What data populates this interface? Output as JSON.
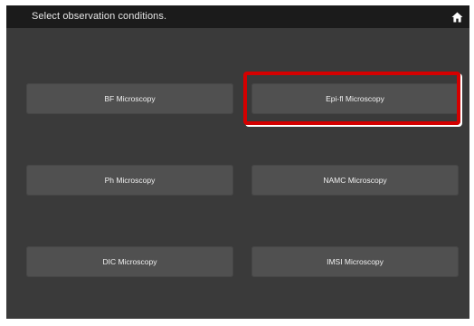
{
  "header": {
    "title": "Select observation conditions.",
    "home_icon": "home-icon"
  },
  "options": [
    {
      "label": "BF Microscopy"
    },
    {
      "label": "Epi-fl Microscopy",
      "highlighted": true
    },
    {
      "label": "Ph Microscopy"
    },
    {
      "label": "NAMC Microscopy"
    },
    {
      "label": "DIC Microscopy"
    },
    {
      "label": "IMSI Microscopy"
    }
  ],
  "colors": {
    "background": "#3a3a3a",
    "header": "#1b1b1b",
    "button": "#505050",
    "highlight": "#d40000"
  }
}
